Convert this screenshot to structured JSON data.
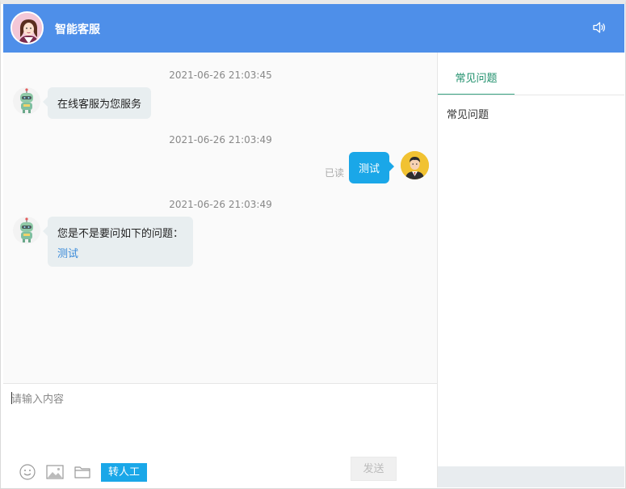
{
  "header": {
    "title": "智能客服",
    "agent_avatar_icon": "female-agent-avatar",
    "sound_icon": "speaker-icon",
    "color": "#4e8fe9"
  },
  "messages": [
    {
      "timestamp": "2021-06-26 21:03:45",
      "from": "bot",
      "text": "在线客服为您服务"
    },
    {
      "timestamp": "2021-06-26 21:03:49",
      "from": "user",
      "text": "测试",
      "status": "已读"
    },
    {
      "timestamp": "2021-06-26 21:03:49",
      "from": "bot",
      "text": "您是不是要问如下的问题：",
      "link": "测试"
    }
  ],
  "input": {
    "placeholder": "请输入内容",
    "value": ""
  },
  "toolbar": {
    "emoji_icon": "emoji-icon",
    "image_icon": "image-icon",
    "file_icon": "folder-icon",
    "transfer_label": "转人工",
    "send_label": "发送"
  },
  "sidebar": {
    "tab_label": "常见问题",
    "content": "常见问题"
  }
}
